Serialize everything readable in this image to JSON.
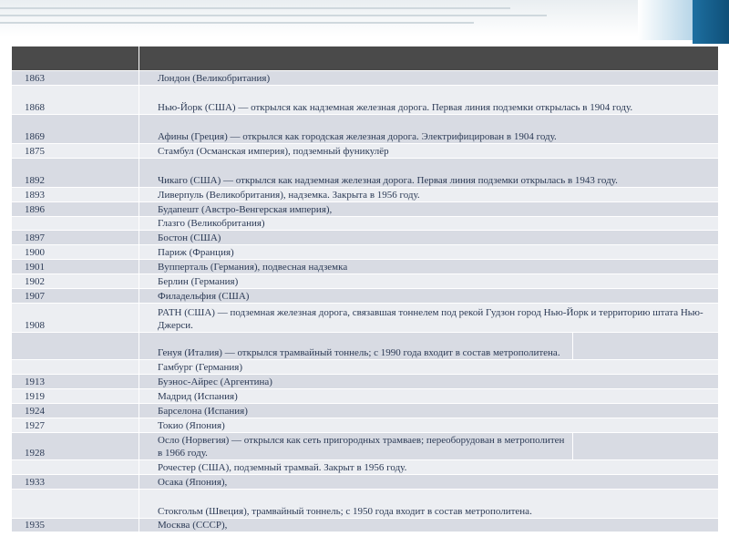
{
  "rows": [
    {
      "year": "1863",
      "text": "Лондон (Великобритания)"
    },
    {
      "year": "1868",
      "text": "Нью-Йорк (США) — открылся как надземная железная дорога. Первая линия подземки открылась в 1904 году."
    },
    {
      "year": "1869",
      "text": "Афины (Греция) — открылся как городская железная дорога. Электрифицирован в 1904 году."
    },
    {
      "year": "1875",
      "text": "Стамбул (Османская империя), подземный фуникулёр"
    },
    {
      "year": "1892",
      "text": "Чикаго (США) — открылся как надземная железная дорога. Первая линия подземки открылась в 1943 году."
    },
    {
      "year": "1893",
      "text": "Ливерпуль (Великобритания), надземка. Закрыта в 1956 году."
    },
    {
      "year": "1896",
      "text": "Будапешт (Австро-Венгерская империя),"
    },
    {
      "year": "",
      "text": "Глазго (Великобритания)"
    },
    {
      "year": "1897",
      "text": "Бостон (США)"
    },
    {
      "year": "1900",
      "text": "Париж (Франция)"
    },
    {
      "year": "1901",
      "text": "Вупперталь (Германия), подвесная надземка"
    },
    {
      "year": "1902",
      "text": "Берлин (Германия)"
    },
    {
      "year": "1907",
      "text": "Филадельфия (США)"
    },
    {
      "year": "1908",
      "text": "PATH (США) — подземная железная дорога, связавшая тоннелем под рекой Гудзон город Нью-Йорк и территорию штата Нью-Джерси."
    },
    {
      "year": "",
      "text": "Генуя (Италия) — открылся трамвайный тоннель; с 1990 года входит в состав метрополитена."
    },
    {
      "year": "",
      "text": "Гамбург (Германия)"
    },
    {
      "year": "1913",
      "text": "Буэнос-Айрес (Аргентина)"
    },
    {
      "year": "1919",
      "text": "Мадрид (Испания)"
    },
    {
      "year": "1924",
      "text": "Барселона (Испания)"
    },
    {
      "year": "1927",
      "text": "Токио (Япония)"
    },
    {
      "year": "1928",
      "text": "Осло (Норвегия) — открылся как сеть пригородных трамваев; переоборудован в метрополитен в 1966 году."
    },
    {
      "year": "",
      "text": "Рочестер (США), подземный трамвай. Закрыт в 1956 году."
    },
    {
      "year": "1933",
      "text": "Осака (Япония),"
    },
    {
      "year": "",
      "text": "Стокгольм (Швеция), трамвайный тоннель; с 1950 года входит в состав метрополитена."
    },
    {
      "year": "1935",
      "text": "Москва (СССР),"
    }
  ]
}
